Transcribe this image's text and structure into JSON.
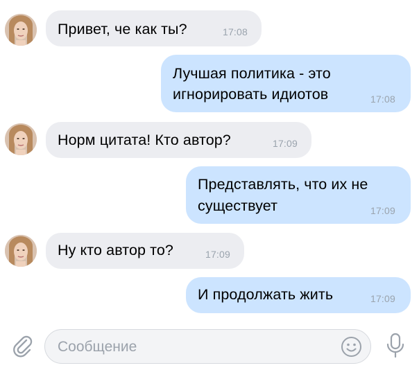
{
  "messages": [
    {
      "direction": "incoming",
      "text": "Привет, че как ты?",
      "time": "17:08"
    },
    {
      "direction": "outgoing",
      "text": "Лучшая политика - это\nигнорировать идиотов",
      "time": "17:08"
    },
    {
      "direction": "incoming",
      "text": "Норм цитата! Кто автор?",
      "time": "17:09"
    },
    {
      "direction": "outgoing",
      "text": "Представлять, что их не\nсуществует",
      "time": "17:09"
    },
    {
      "direction": "incoming",
      "text": "Ну кто автор то?",
      "time": "17:09"
    },
    {
      "direction": "outgoing",
      "text": "И продолжать жить",
      "time": "17:09"
    }
  ],
  "composer": {
    "placeholder": "Сообщение",
    "attach_icon": "paperclip-icon",
    "emoji_icon": "smiley-icon",
    "mic_icon": "microphone-icon"
  },
  "colors": {
    "incoming_bubble": "#ecedf1",
    "outgoing_bubble": "#cce4ff",
    "timestamp": "#9aa3ad",
    "icons": "#9ba2ab"
  }
}
